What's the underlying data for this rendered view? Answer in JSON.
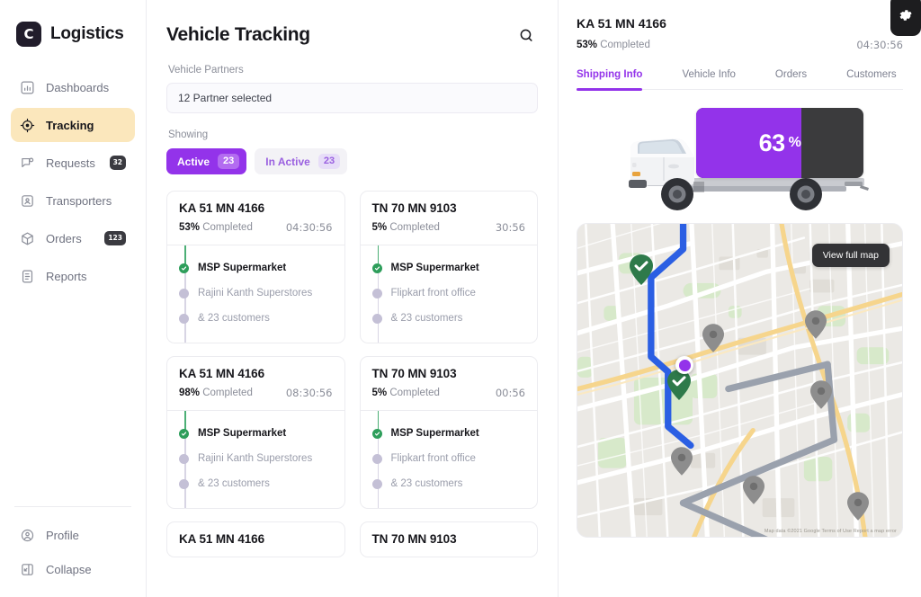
{
  "brand": {
    "mark_letter": "C",
    "name": "Logistics"
  },
  "sidebar": {
    "items": [
      {
        "label": "Dashboards",
        "icon": "chart-bar-icon",
        "badge": null,
        "active": false
      },
      {
        "label": "Tracking",
        "icon": "target-icon",
        "badge": null,
        "active": true
      },
      {
        "label": "Requests",
        "icon": "chat-bubble-icon",
        "badge": "32",
        "active": false
      },
      {
        "label": "Transporters",
        "icon": "id-card-icon",
        "badge": null,
        "active": false
      },
      {
        "label": "Orders",
        "icon": "box-icon",
        "badge": "123",
        "active": false
      },
      {
        "label": "Reports",
        "icon": "document-icon",
        "badge": null,
        "active": false
      }
    ],
    "bottom_items": [
      {
        "label": "Profile",
        "icon": "user-circle-icon"
      },
      {
        "label": "Collapse",
        "icon": "collapse-panel-icon"
      }
    ]
  },
  "main": {
    "title": "Vehicle Tracking",
    "search_icon": "search-icon",
    "partners_label": "Vehicle Partners",
    "partners_value": "12 Partner selected",
    "showing_label": "Showing",
    "filters": [
      {
        "label": "Active",
        "count": "23",
        "selected": true
      },
      {
        "label": "In Active",
        "count": "23",
        "selected": false
      }
    ],
    "vehicles": [
      {
        "plate": "KA 51 MN 4166",
        "percent": "53%",
        "completed_label": "Completed",
        "time": "04:30:56",
        "stops": [
          {
            "name": "MSP Supermarket",
            "done": true
          },
          {
            "name": "Rajini Kanth Superstores",
            "done": false
          },
          {
            "name": "& 23 customers",
            "done": false
          }
        ]
      },
      {
        "plate": "TN 70 MN 9103",
        "percent": "5%",
        "completed_label": "Completed",
        "time": "30:56",
        "stops": [
          {
            "name": "MSP Supermarket",
            "done": true
          },
          {
            "name": "Flipkart front office",
            "done": false
          },
          {
            "name": "& 23 customers",
            "done": false
          }
        ]
      },
      {
        "plate": "KA 51 MN 4166",
        "percent": "98%",
        "completed_label": "Completed",
        "time": "08:30:56",
        "stops": [
          {
            "name": "MSP Supermarket",
            "done": true
          },
          {
            "name": "Rajini Kanth Superstores",
            "done": false
          },
          {
            "name": "& 23 customers",
            "done": false
          }
        ]
      },
      {
        "plate": "TN 70 MN 9103",
        "percent": "5%",
        "completed_label": "Completed",
        "time": "00:56",
        "stops": [
          {
            "name": "MSP Supermarket",
            "done": true
          },
          {
            "name": "Flipkart front office",
            "done": false
          },
          {
            "name": "& 23 customers",
            "done": false
          }
        ]
      },
      {
        "plate": "KA 51 MN 4166",
        "percent": "",
        "completed_label": "",
        "time": "",
        "stops": []
      },
      {
        "plate": "TN 70 MN 9103",
        "percent": "",
        "completed_label": "",
        "time": "",
        "stops": []
      }
    ]
  },
  "detail": {
    "gear_icon": "gear-icon",
    "plate": "KA 51 MN 4166",
    "percent": "53%",
    "completed_label": "Completed",
    "time": "04:30:56",
    "tabs": [
      {
        "label": "Shipping Info",
        "active": true
      },
      {
        "label": "Vehicle Info",
        "active": false
      },
      {
        "label": "Orders",
        "active": false
      },
      {
        "label": "Customers",
        "active": false
      }
    ],
    "truck_progress": {
      "value": 63,
      "number": "63",
      "symbol": "%"
    },
    "map": {
      "view_full_map_label": "View full map",
      "attribution": "Map data ©2021 Google   Terms of Use   Report a map error",
      "completed_route_color": "#2b5fe3",
      "upcoming_route_color": "#9aa1ad",
      "current_position_color": "#9333ea",
      "done_marker_color": "#2e7a4a",
      "pending_marker_color": "#8d8d8d"
    }
  },
  "colors": {
    "accent": "#9333ea",
    "active_nav_bg": "#fbe7bc",
    "done_green": "#2e9e5b",
    "dark": "#1d1d1f"
  }
}
